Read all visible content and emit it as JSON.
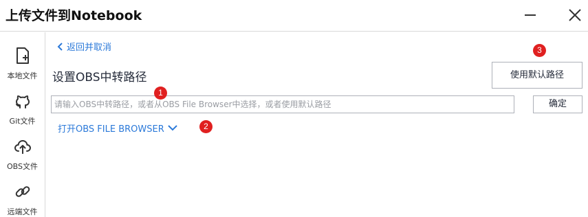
{
  "window": {
    "title": "上传文件到Notebook",
    "minimize_icon": "minimize-icon",
    "close_icon": "close-icon"
  },
  "sidebar": {
    "items": [
      {
        "label": "本地文件",
        "icon": "local-file-icon"
      },
      {
        "label": "Git文件",
        "icon": "github-icon"
      },
      {
        "label": "OBS文件",
        "icon": "cloud-upload-icon"
      },
      {
        "label": "远端文件",
        "icon": "link-icon"
      }
    ]
  },
  "main": {
    "back_link": "返回并取消",
    "section_title": "设置OBS中转路径",
    "default_path_button": "使用默认路径",
    "path_input": {
      "value": "",
      "placeholder": "请输入OBS中转路径，或者从OBS File Browser中选择，或者使用默认路径"
    },
    "confirm_button": "确定",
    "open_browser_link": "打开OBS FILE BROWSER"
  },
  "markers": [
    "1",
    "2",
    "3"
  ],
  "colors": {
    "link": "#2b79d9",
    "marker": "#e02020",
    "border": "#adb0b8",
    "text": "#252b3a"
  }
}
